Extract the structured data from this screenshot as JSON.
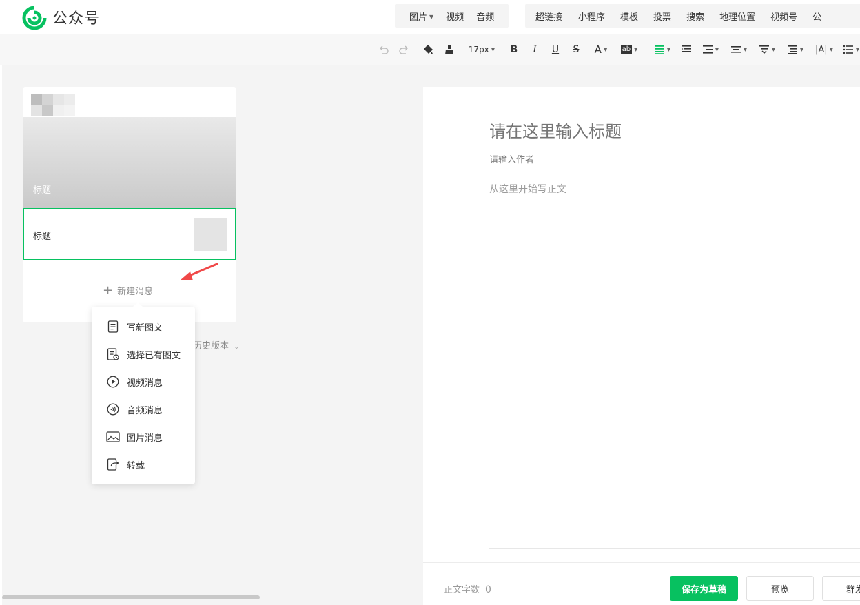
{
  "brand": {
    "name": "公众号"
  },
  "insert_bar": {
    "group1": [
      {
        "label": "图片",
        "has_dropdown": true
      },
      {
        "label": "视频",
        "has_dropdown": false
      },
      {
        "label": "音频",
        "has_dropdown": false
      }
    ],
    "group2": [
      "超链接",
      "小程序",
      "模板",
      "投票",
      "搜索",
      "地理位置",
      "视频号",
      "公"
    ]
  },
  "toolbar": {
    "font_size": "17px",
    "buttons": [
      "undo-icon",
      "redo-icon",
      "format-painter-icon",
      "clear-format-icon",
      "bold-icon",
      "italic-icon",
      "underline-icon",
      "strikethrough-icon",
      "font-color-icon",
      "background-color-icon",
      "align-icon",
      "indent-icon",
      "line-spacing-icon",
      "paragraph-spacing-icon",
      "letter-spacing-icon",
      "list-icon"
    ],
    "bold": "B",
    "italic": "I",
    "underline": "U",
    "strike": "S",
    "font_color": "A",
    "bg_color": "ab",
    "accent": "#07c160"
  },
  "left_panel": {
    "cover_title": "标题",
    "sub_item_title": "标题",
    "new_message": "新建消息",
    "history": "历史版本"
  },
  "new_menu": {
    "items": [
      {
        "label": "写新图文",
        "icon": "document-icon"
      },
      {
        "label": "选择已有图文",
        "icon": "existing-document-icon"
      },
      {
        "label": "视频消息",
        "icon": "play-icon"
      },
      {
        "label": "音频消息",
        "icon": "audio-icon"
      },
      {
        "label": "图片消息",
        "icon": "image-icon"
      },
      {
        "label": "转载",
        "icon": "repost-icon"
      }
    ]
  },
  "editor": {
    "title_placeholder": "请在这里输入标题",
    "author_placeholder": "请输入作者",
    "body_placeholder": "从这里开始写正文"
  },
  "footer": {
    "word_count_label": "正文字数",
    "word_count": "0",
    "save_draft": "保存为草稿",
    "preview": "预览",
    "mass_send": "群发"
  },
  "colors": {
    "primary": "#07c160",
    "arrow": "#f04848"
  }
}
